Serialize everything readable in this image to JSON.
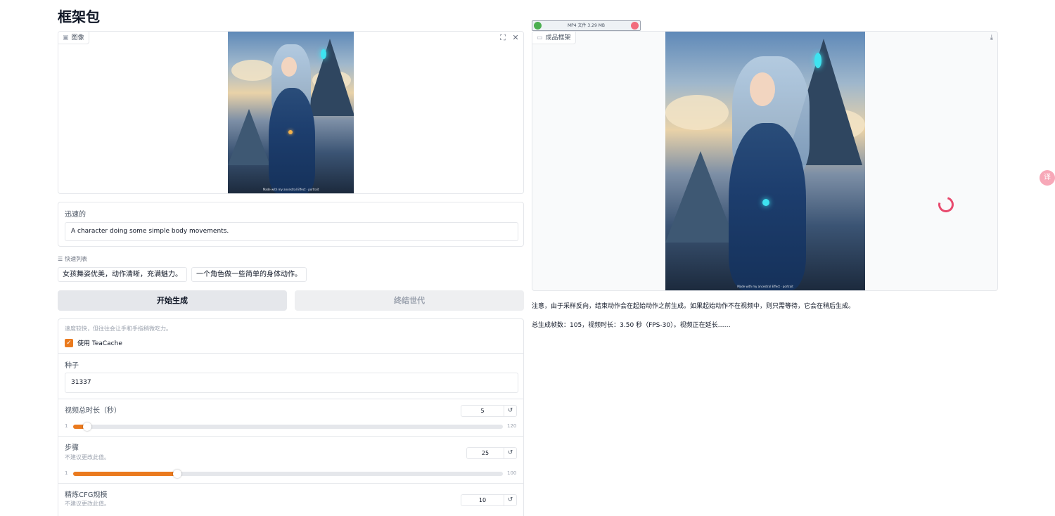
{
  "app": {
    "title": "框架包"
  },
  "image_panel": {
    "label": "图像",
    "caption": "Made with my ancestral Effect · portrait"
  },
  "prompt": {
    "label": "迅速的",
    "value": "A character doing some simple body movements."
  },
  "quick_list": {
    "label": "快速列表",
    "items": [
      "女孩舞姿优美，动作清晰，充满魅力。",
      "一个角色做一些简单的身体动作。"
    ]
  },
  "buttons": {
    "start": "开始生成",
    "end": "终结世代"
  },
  "settings": {
    "teacache_hint": "速度较快，但往往会让手和手指稍微吃力。",
    "teacache_label": "使用 TeaCache",
    "teacache_checked": true,
    "seed": {
      "label": "种子",
      "value": "31337"
    },
    "duration": {
      "label": "视频总时长（秒）",
      "value": "5",
      "min": "1",
      "max": "120",
      "fraction": 0.033
    },
    "steps": {
      "label": "步骤",
      "hint": "不建议更改此值。",
      "value": "25",
      "min": "1",
      "max": "100",
      "fraction": 0.242
    },
    "cfg": {
      "label": "精炼CFG规模",
      "hint": "不建议更改此值。",
      "value": "10"
    }
  },
  "download_badge": {
    "text": "MP4 文件 3.29 MB"
  },
  "video_panel": {
    "label": "成品框架",
    "caption": "Made with my ancestral Effect · portrait"
  },
  "notes": {
    "warning": "注意，由于采样反向，结束动作会在起始动作之前生成。如果起始动作不在视频中，则只需等待，它会在稍后生成。",
    "status": "总生成帧数：105，视频时长：3.50 秒（FPS-30）。视频正在延长……"
  },
  "icons": {
    "image": "image-icon",
    "fullscreen": "fullscreen-icon",
    "close": "close-icon",
    "list": "list-icon",
    "check": "check-icon",
    "reset": "reset-icon",
    "video": "video-icon",
    "download": "download-icon",
    "translate": "translate-icon"
  },
  "colors": {
    "accent": "#ea7a1e",
    "loader": "#e8496d"
  }
}
